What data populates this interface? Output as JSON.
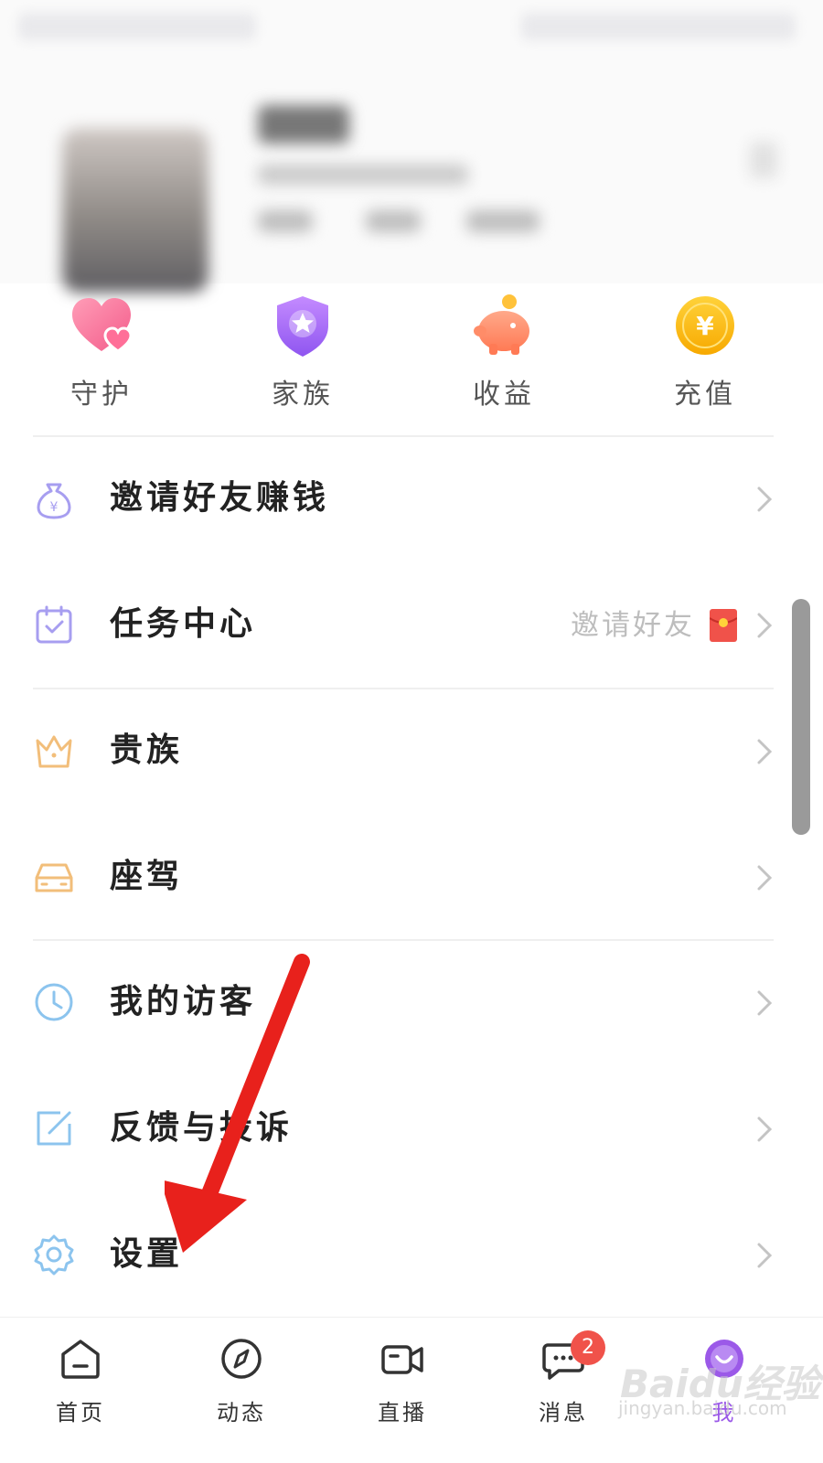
{
  "quick_actions": [
    {
      "label": "守护",
      "icon": "heart-icon"
    },
    {
      "label": "家族",
      "icon": "shield-star-icon"
    },
    {
      "label": "收益",
      "icon": "piggy-bank-icon"
    },
    {
      "label": "充值",
      "icon": "coin-icon"
    }
  ],
  "menu": {
    "invite": {
      "label": "邀请好友赚钱",
      "icon": "money-bag-icon"
    },
    "tasks": {
      "label": "任务中心",
      "extra": "邀请好友",
      "icon": "calendar-check-icon"
    },
    "noble": {
      "label": "贵族",
      "icon": "crown-icon"
    },
    "mount": {
      "label": "座驾",
      "icon": "car-icon"
    },
    "visitors": {
      "label": "我的访客",
      "icon": "clock-icon"
    },
    "feedback": {
      "label": "反馈与投诉",
      "icon": "edit-icon"
    },
    "settings": {
      "label": "设置",
      "icon": "gear-icon"
    }
  },
  "bottom_nav": [
    {
      "label": "首页",
      "icon": "home-icon"
    },
    {
      "label": "动态",
      "icon": "compass-icon"
    },
    {
      "label": "直播",
      "icon": "video-icon"
    },
    {
      "label": "消息",
      "icon": "message-icon",
      "badge": "2"
    },
    {
      "label": "我",
      "icon": "profile-icon",
      "active": true
    }
  ],
  "colors": {
    "accent": "#9b59e8",
    "badge": "#f0524a",
    "arrow": "#e8211c"
  },
  "watermark": {
    "text": "Baidu经验",
    "url": "jingyan.baidu.com"
  }
}
